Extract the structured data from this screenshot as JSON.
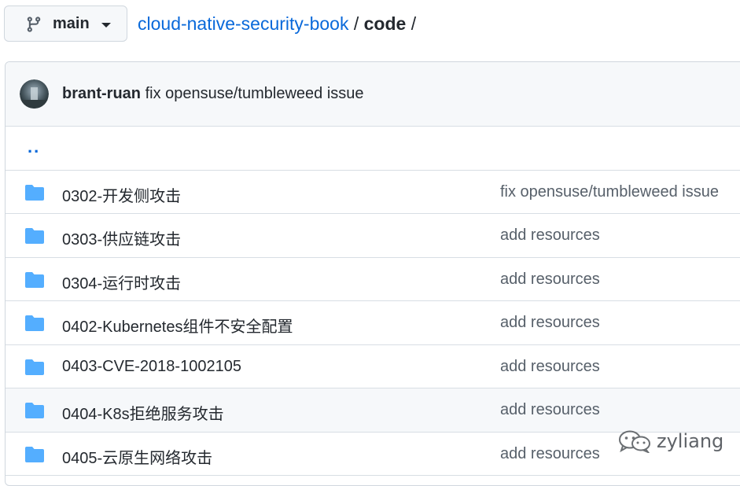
{
  "branch": {
    "label": "main",
    "icon": "git-branch-icon"
  },
  "breadcrumb": {
    "repo": "cloud-native-security-book",
    "sep1": " / ",
    "path": "code",
    "sep2": " /"
  },
  "latest_commit": {
    "author": "brant-ruan",
    "message": "fix opensuse/tumbleweed issue"
  },
  "parent_dir": {
    "label": ".."
  },
  "files": [
    {
      "name": "0302-开发侧攻击",
      "commit": "fix opensuse/tumbleweed issue"
    },
    {
      "name": "0303-供应链攻击",
      "commit": "add resources"
    },
    {
      "name": "0304-运行时攻击",
      "commit": "add resources"
    },
    {
      "name": "0402-Kubernetes组件不安全配置",
      "commit": "add resources"
    },
    {
      "name": "0403-CVE-2018-1002105",
      "commit": "add resources"
    },
    {
      "name": "0404-K8s拒绝服务攻击",
      "commit": "add resources"
    },
    {
      "name": "0405-云原生网络攻击",
      "commit": "add resources"
    }
  ],
  "watermark": {
    "text": "zyliang",
    "icon": "wechat-icon"
  },
  "colors": {
    "link": "#0969da",
    "folder": "#54aeff",
    "muted": "#57606a",
    "border": "#d0d7de"
  }
}
